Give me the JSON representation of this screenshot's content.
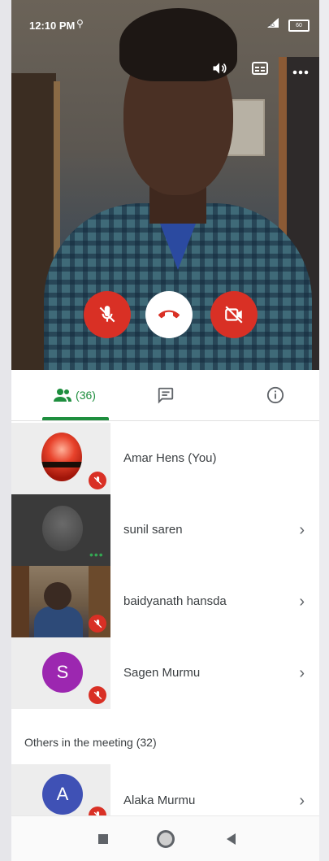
{
  "status_bar": {
    "time": "12:10 PM",
    "battery": "60"
  },
  "colors": {
    "accent_green": "#1e8e3e",
    "end_call_red": "#d93025",
    "avatar_purple": "#9c27b0",
    "avatar_indigo": "#3f51b5"
  },
  "tabs": {
    "people_label": "(36)"
  },
  "participants": [
    {
      "name": "Amar Hens (You)"
    },
    {
      "name": "sunil saren"
    },
    {
      "name": "baidyanath hansda"
    },
    {
      "name": "Sagen Murmu",
      "initial": "S"
    }
  ],
  "others": {
    "header": "Others in the meeting (32)",
    "items": [
      {
        "name": "Alaka Murmu",
        "initial": "A"
      }
    ]
  }
}
